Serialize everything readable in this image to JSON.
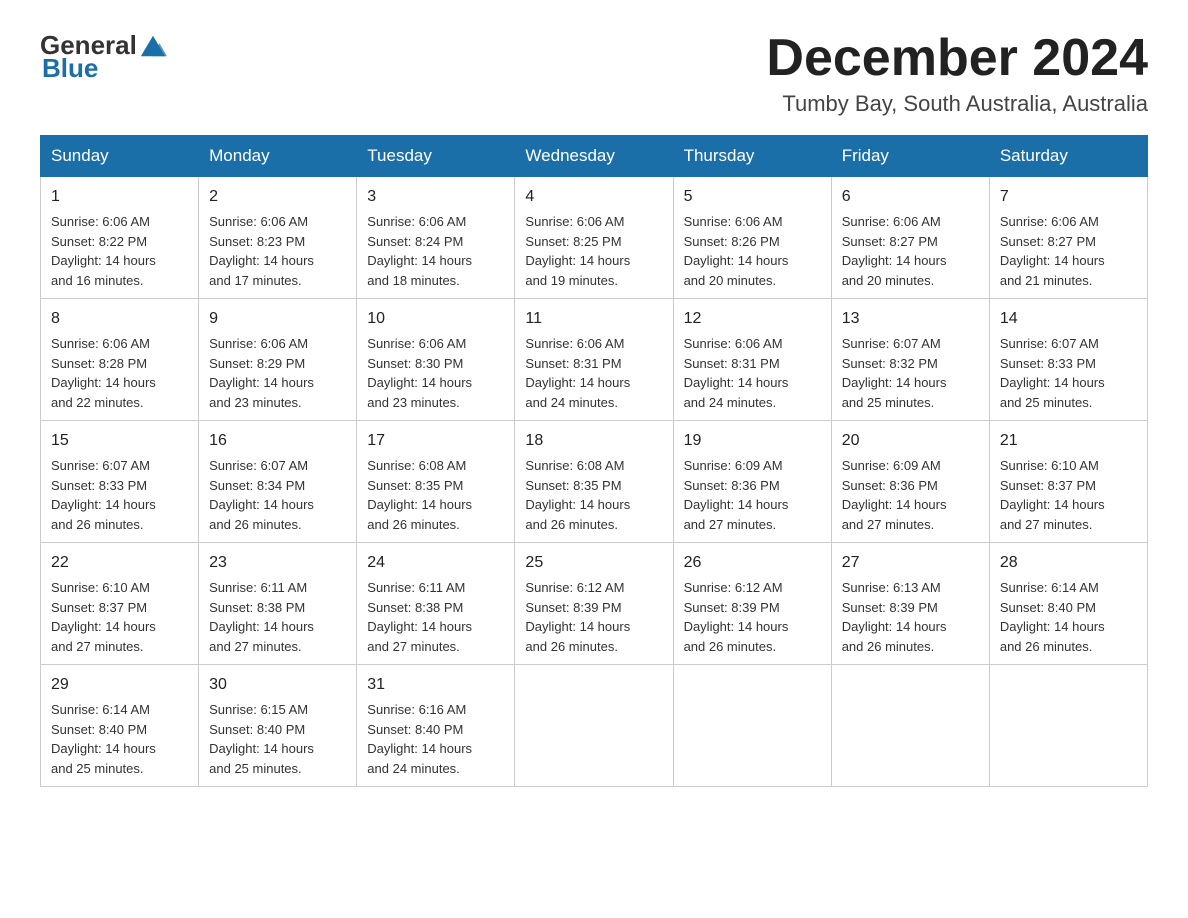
{
  "header": {
    "logo_general": "General",
    "logo_blue": "Blue",
    "month_title": "December 2024",
    "location": "Tumby Bay, South Australia, Australia"
  },
  "weekdays": [
    "Sunday",
    "Monday",
    "Tuesday",
    "Wednesday",
    "Thursday",
    "Friday",
    "Saturday"
  ],
  "weeks": [
    [
      {
        "day": "1",
        "sunrise": "6:06 AM",
        "sunset": "8:22 PM",
        "daylight": "14 hours and 16 minutes."
      },
      {
        "day": "2",
        "sunrise": "6:06 AM",
        "sunset": "8:23 PM",
        "daylight": "14 hours and 17 minutes."
      },
      {
        "day": "3",
        "sunrise": "6:06 AM",
        "sunset": "8:24 PM",
        "daylight": "14 hours and 18 minutes."
      },
      {
        "day": "4",
        "sunrise": "6:06 AM",
        "sunset": "8:25 PM",
        "daylight": "14 hours and 19 minutes."
      },
      {
        "day": "5",
        "sunrise": "6:06 AM",
        "sunset": "8:26 PM",
        "daylight": "14 hours and 20 minutes."
      },
      {
        "day": "6",
        "sunrise": "6:06 AM",
        "sunset": "8:27 PM",
        "daylight": "14 hours and 20 minutes."
      },
      {
        "day": "7",
        "sunrise": "6:06 AM",
        "sunset": "8:27 PM",
        "daylight": "14 hours and 21 minutes."
      }
    ],
    [
      {
        "day": "8",
        "sunrise": "6:06 AM",
        "sunset": "8:28 PM",
        "daylight": "14 hours and 22 minutes."
      },
      {
        "day": "9",
        "sunrise": "6:06 AM",
        "sunset": "8:29 PM",
        "daylight": "14 hours and 23 minutes."
      },
      {
        "day": "10",
        "sunrise": "6:06 AM",
        "sunset": "8:30 PM",
        "daylight": "14 hours and 23 minutes."
      },
      {
        "day": "11",
        "sunrise": "6:06 AM",
        "sunset": "8:31 PM",
        "daylight": "14 hours and 24 minutes."
      },
      {
        "day": "12",
        "sunrise": "6:06 AM",
        "sunset": "8:31 PM",
        "daylight": "14 hours and 24 minutes."
      },
      {
        "day": "13",
        "sunrise": "6:07 AM",
        "sunset": "8:32 PM",
        "daylight": "14 hours and 25 minutes."
      },
      {
        "day": "14",
        "sunrise": "6:07 AM",
        "sunset": "8:33 PM",
        "daylight": "14 hours and 25 minutes."
      }
    ],
    [
      {
        "day": "15",
        "sunrise": "6:07 AM",
        "sunset": "8:33 PM",
        "daylight": "14 hours and 26 minutes."
      },
      {
        "day": "16",
        "sunrise": "6:07 AM",
        "sunset": "8:34 PM",
        "daylight": "14 hours and 26 minutes."
      },
      {
        "day": "17",
        "sunrise": "6:08 AM",
        "sunset": "8:35 PM",
        "daylight": "14 hours and 26 minutes."
      },
      {
        "day": "18",
        "sunrise": "6:08 AM",
        "sunset": "8:35 PM",
        "daylight": "14 hours and 26 minutes."
      },
      {
        "day": "19",
        "sunrise": "6:09 AM",
        "sunset": "8:36 PM",
        "daylight": "14 hours and 27 minutes."
      },
      {
        "day": "20",
        "sunrise": "6:09 AM",
        "sunset": "8:36 PM",
        "daylight": "14 hours and 27 minutes."
      },
      {
        "day": "21",
        "sunrise": "6:10 AM",
        "sunset": "8:37 PM",
        "daylight": "14 hours and 27 minutes."
      }
    ],
    [
      {
        "day": "22",
        "sunrise": "6:10 AM",
        "sunset": "8:37 PM",
        "daylight": "14 hours and 27 minutes."
      },
      {
        "day": "23",
        "sunrise": "6:11 AM",
        "sunset": "8:38 PM",
        "daylight": "14 hours and 27 minutes."
      },
      {
        "day": "24",
        "sunrise": "6:11 AM",
        "sunset": "8:38 PM",
        "daylight": "14 hours and 27 minutes."
      },
      {
        "day": "25",
        "sunrise": "6:12 AM",
        "sunset": "8:39 PM",
        "daylight": "14 hours and 26 minutes."
      },
      {
        "day": "26",
        "sunrise": "6:12 AM",
        "sunset": "8:39 PM",
        "daylight": "14 hours and 26 minutes."
      },
      {
        "day": "27",
        "sunrise": "6:13 AM",
        "sunset": "8:39 PM",
        "daylight": "14 hours and 26 minutes."
      },
      {
        "day": "28",
        "sunrise": "6:14 AM",
        "sunset": "8:40 PM",
        "daylight": "14 hours and 26 minutes."
      }
    ],
    [
      {
        "day": "29",
        "sunrise": "6:14 AM",
        "sunset": "8:40 PM",
        "daylight": "14 hours and 25 minutes."
      },
      {
        "day": "30",
        "sunrise": "6:15 AM",
        "sunset": "8:40 PM",
        "daylight": "14 hours and 25 minutes."
      },
      {
        "day": "31",
        "sunrise": "6:16 AM",
        "sunset": "8:40 PM",
        "daylight": "14 hours and 24 minutes."
      },
      null,
      null,
      null,
      null
    ]
  ],
  "labels": {
    "sunrise": "Sunrise:",
    "sunset": "Sunset:",
    "daylight": "Daylight:"
  }
}
